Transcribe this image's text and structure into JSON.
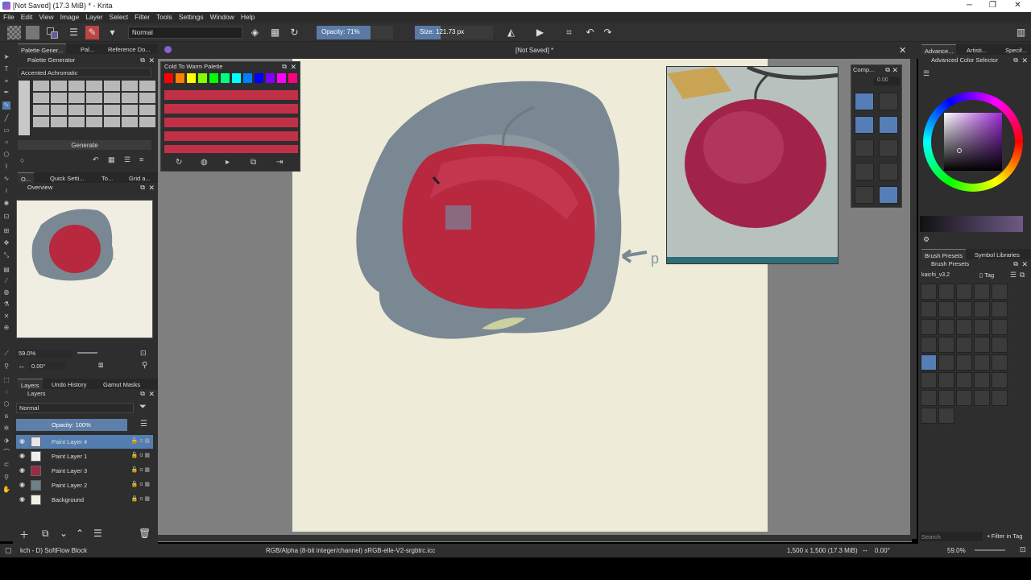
{
  "window": {
    "title": "[Not Saved]  (17.3 MiB)  * - Krita",
    "minimize": "─",
    "maximize": "❐",
    "close": "✕"
  },
  "menu": [
    "File",
    "Edit",
    "View",
    "Image",
    "Layer",
    "Select",
    "Filter",
    "Tools",
    "Settings",
    "Window",
    "Help"
  ],
  "toolbar": {
    "blend_mode": "Normal",
    "opacity": "Opacity: 71%",
    "opacity_value": 0.71,
    "size": "Size: 121.73 px",
    "size_fill": 0.33
  },
  "palette_generator": {
    "tabs": [
      "Palette Gener...",
      "Pal...",
      "Reference Do..."
    ],
    "title": "Palette Generator",
    "preset": "Accented Achromatic",
    "generate": "Generate"
  },
  "overview": {
    "tabs": [
      "O...",
      "Quick Setti...",
      "To...",
      "Grid a..."
    ],
    "title": "Overview",
    "zoom": "59.0%",
    "rotation": "0.00°"
  },
  "layers": {
    "tabs": [
      "Layers",
      "Undo History",
      "Gamut Masks"
    ],
    "title": "Layers",
    "blend_mode": "Normal",
    "opacity": "Opacity:  100%",
    "items": [
      {
        "name": "Paint Layer 4",
        "active": true,
        "thumb": "#e6e6e6"
      },
      {
        "name": "Paint Layer 1",
        "active": false,
        "thumb": "#eee"
      },
      {
        "name": "Paint Layer 3",
        "active": false,
        "thumb": "#9a2a45"
      },
      {
        "name": "Paint Layer 2",
        "active": false,
        "thumb": "#6d7f88"
      },
      {
        "name": "Background",
        "active": false,
        "thumb": "#f3f0e4"
      }
    ]
  },
  "canvas": {
    "tab_title": "[Not Saved]  *"
  },
  "cold_warm": {
    "title": "Cold To Warm Palette"
  },
  "comp": {
    "title": "Comp...",
    "value": "0.00"
  },
  "right": {
    "tabs": [
      "Advance...",
      "Artisti...",
      "Specif..."
    ],
    "title": "Advanced Color Selector",
    "brush_tabs": [
      "Brush Presets",
      "Symbol Libraries"
    ],
    "brush_title": "Brush Presets",
    "brush_tag": "kaichi_v3.2",
    "tag_label": "Tag",
    "search": "Search",
    "filter": "Filter in Tag"
  },
  "status": {
    "brush": "kch - D) SoftFlow Block",
    "color_space": "RGB/Alpha (8-bit integer/channel)  sRGB-elle-V2-srgbtrc.icc",
    "dimensions": "1,500 x 1,500 (17.3 MiB)",
    "rotation": "0.00°",
    "zoom": "59.0%"
  },
  "colors": {
    "accent": "#547eb1",
    "apple": "#b8283f",
    "apple_bg": "#7a8893",
    "paper": "#eeebd9"
  }
}
